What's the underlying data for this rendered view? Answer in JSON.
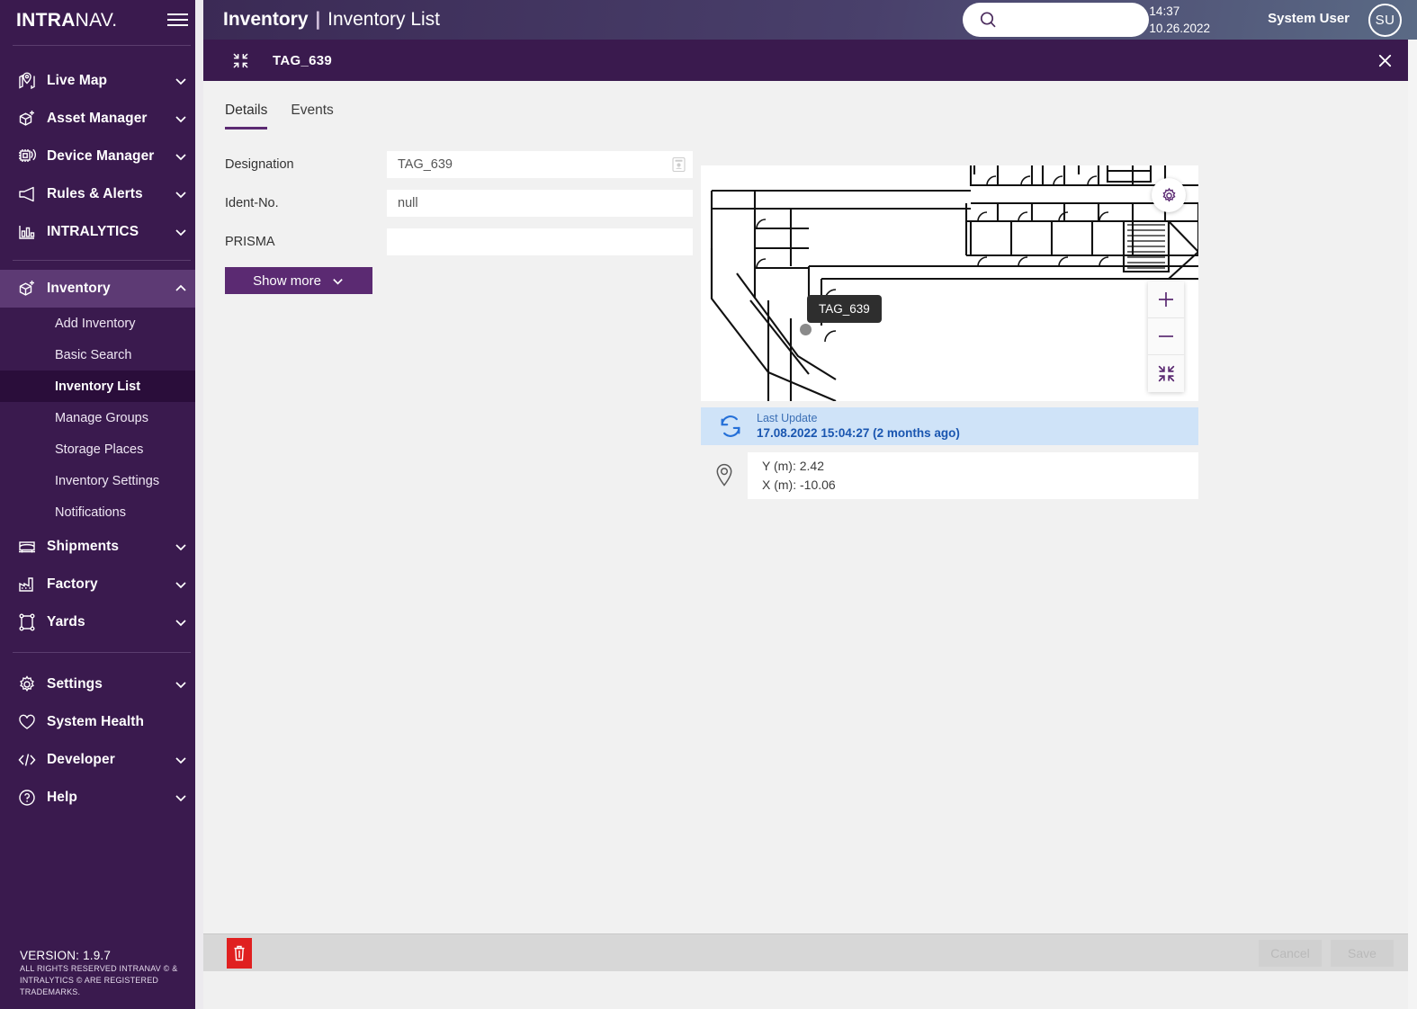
{
  "brand": {
    "part1": "INTRA",
    "part2": "NAV",
    "dot": "."
  },
  "sidebar": {
    "menu_icon": "hamburger-icon",
    "items": [
      {
        "label": "Live Map",
        "icon": "map-pin-icon",
        "chevron": "chevron-down-icon"
      },
      {
        "label": "Asset Manager",
        "icon": "cube-plus-icon",
        "chevron": "chevron-down-icon"
      },
      {
        "label": "Device Manager",
        "icon": "device-signal-icon",
        "chevron": "chevron-down-icon"
      },
      {
        "label": "Rules & Alerts",
        "icon": "megaphone-icon",
        "chevron": "chevron-down-icon"
      },
      {
        "label": "INTRALYTICS",
        "icon": "bar-chart-icon",
        "chevron": "chevron-down-icon"
      }
    ],
    "inventory": {
      "label": "Inventory",
      "icon": "cube-plus-icon",
      "chevron": "chevron-up-icon"
    },
    "inventory_sub": [
      "Add Inventory",
      "Basic Search",
      "Inventory List",
      "Manage Groups",
      "Storage Places",
      "Inventory Settings",
      "Notifications"
    ],
    "inventory_selected": "Inventory List",
    "items2": [
      {
        "label": "Shipments",
        "icon": "truck-icon",
        "chevron": "chevron-down-icon"
      },
      {
        "label": "Factory",
        "icon": "factory-icon",
        "chevron": "chevron-down-icon"
      },
      {
        "label": "Yards",
        "icon": "yard-icon",
        "chevron": "chevron-down-icon"
      }
    ],
    "items3": [
      {
        "label": "Settings",
        "icon": "gear-icon",
        "chevron": "chevron-down-icon"
      },
      {
        "label": "System Health",
        "icon": "heart-icon",
        "chevron": ""
      },
      {
        "label": "Developer",
        "icon": "code-icon",
        "chevron": "chevron-down-icon"
      },
      {
        "label": "Help",
        "icon": "question-circle-icon",
        "chevron": "chevron-down-icon"
      }
    ],
    "version": "VERSION: 1.9.7",
    "trademark": "ALL RIGHTS RESERVED INTRANAV © & INTRALYTICS © ARE REGISTERED TRADEMARKS."
  },
  "topbar": {
    "title_strong": "Inventory",
    "title_sep": "|",
    "title_light": "Inventory List",
    "search_placeholder": "",
    "search_value": "",
    "time": "14:37",
    "date": "10.26.2022",
    "user_name": "System User",
    "avatar_initials": "SU"
  },
  "detail_header": {
    "collapse_icon": "collapse-arrows-icon",
    "title": "TAG_639",
    "close_label": "×"
  },
  "tabs": [
    {
      "label": "Details",
      "active": true
    },
    {
      "label": "Events",
      "active": false
    }
  ],
  "form": {
    "fields": [
      {
        "label": "Designation",
        "value": "TAG_639",
        "trailing_icon": "tag-badge-icon"
      },
      {
        "label": "Ident-No.",
        "value": "null",
        "trailing_icon": ""
      },
      {
        "label": "PRISMA",
        "value": "",
        "trailing_icon": ""
      }
    ],
    "show_more": "Show more",
    "show_more_icon": "chevron-down-icon"
  },
  "map": {
    "tag_label": "TAG_639",
    "gear_icon": "gear-icon",
    "zoom_in": "+",
    "zoom_out": "−",
    "fit_icon": "fit-screen-icon"
  },
  "update": {
    "icon": "refresh-icon",
    "label": "Last Update",
    "value": "17.08.2022 15:04:27 (2 months ago)"
  },
  "coords": {
    "icon": "location-pin-icon",
    "y_line": "Y (m): 2.42",
    "x_line": "X (m): -10.06"
  },
  "actionbar": {
    "delete_icon": "trash-icon",
    "cancel_label": "Cancel",
    "save_label": "Save"
  },
  "colors": {
    "sidebar_bg": "#3a1a4e",
    "accent_purple": "#5b2a72",
    "selected_sub_bg": "#2a0d3a",
    "active_parent_bg": "#5d3a74",
    "banner_bg": "#cfe3f8",
    "banner_text": "#1a56b0",
    "delete_red": "#e02020"
  }
}
